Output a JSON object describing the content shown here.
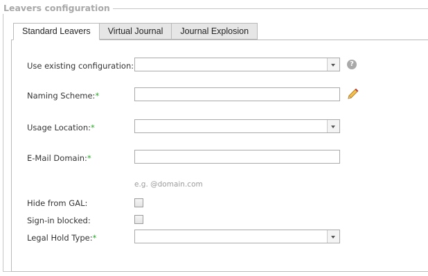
{
  "legend": "Leavers configuration",
  "tabs": [
    {
      "label": "Standard Leavers",
      "active": true
    },
    {
      "label": "Virtual Journal",
      "active": false
    },
    {
      "label": "Journal Explosion",
      "active": false
    }
  ],
  "form": {
    "existing_config": {
      "label": "Use existing configuration:",
      "value": ""
    },
    "naming_scheme": {
      "label": "Naming Scheme:",
      "required_mark": "*",
      "value": ""
    },
    "usage_location": {
      "label": "Usage Location:",
      "required_mark": "*",
      "value": ""
    },
    "email_domain": {
      "label": "E-Mail Domain:",
      "required_mark": "*",
      "value": "",
      "hint": "e.g. @domain.com"
    },
    "hide_from_gal": {
      "label": "Hide from GAL:",
      "checked": false
    },
    "signin_blocked": {
      "label": "Sign-in blocked:",
      "checked": false
    },
    "legal_hold_type": {
      "label": "Legal Hold Type:",
      "required_mark": "*",
      "value": ""
    }
  },
  "icons": {
    "help": "help-icon",
    "edit": "pencil-icon"
  },
  "colors": {
    "required": "#2aa82a",
    "legend": "#a8a8a8",
    "pencil": "#e0a030"
  }
}
